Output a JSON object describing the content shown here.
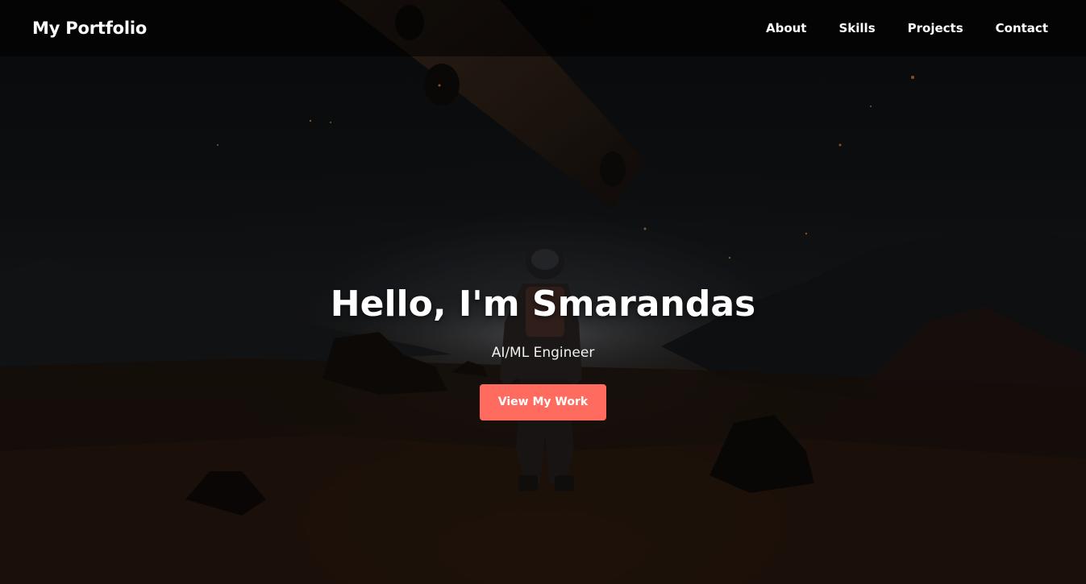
{
  "navbar": {
    "brand": "My Portfolio",
    "links": [
      {
        "label": "About"
      },
      {
        "label": "Skills"
      },
      {
        "label": "Projects"
      },
      {
        "label": "Contact"
      }
    ]
  },
  "hero": {
    "title": "Hello, I'm Smarandas",
    "subtitle": "AI/ML Engineer",
    "cta_label": "View My Work"
  },
  "colors": {
    "accent": "#ff6b5f",
    "navbar_bg": "#000000",
    "text": "#ffffff"
  }
}
